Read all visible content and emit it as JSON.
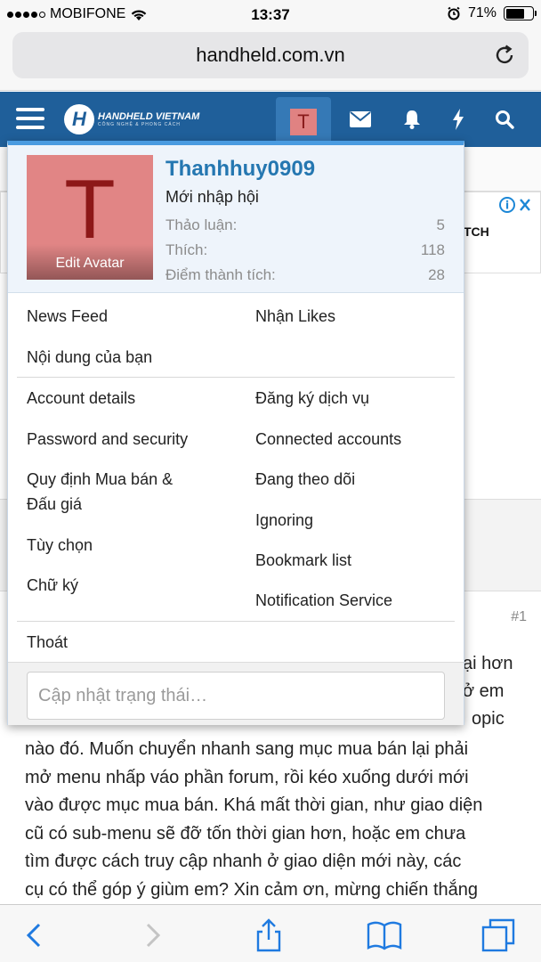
{
  "status_bar": {
    "carrier": "MOBIFONE",
    "time": "13:37",
    "battery_text": "71%",
    "battery_level": 0.71
  },
  "browser": {
    "url": "handheld.com.vn"
  },
  "site": {
    "logo_name": "HANDHELD VIETNAM",
    "logo_tagline": "CÔNG NGHỆ & PHONG CÁCH",
    "avatar_letter": "T",
    "header_color": "#1f5f9a"
  },
  "ad": {
    "brand_fragment": "TCH"
  },
  "popup": {
    "avatar_letter": "T",
    "edit_avatar": "Edit Avatar",
    "username": "Thanhhuy0909",
    "user_title": "Mới nhập hội",
    "stats": [
      {
        "label": "Thảo luận:",
        "value": "5"
      },
      {
        "label": "Thích:",
        "value": "118"
      },
      {
        "label": "Điểm thành tích:",
        "value": "28"
      }
    ],
    "links_top_left": [
      "News Feed",
      "Nội dung của bạn"
    ],
    "links_top_right": [
      "Nhận Likes"
    ],
    "account_left": [
      "Account details",
      "Password and security",
      "Quy định Mua bán &",
      "Đấu giá",
      "Tùy chọn",
      "Chữ ký"
    ],
    "account_right": [
      "Đăng ký dịch vụ",
      "Connected accounts",
      "Đang theo dõi",
      "Ignoring",
      "Bookmark list",
      "Notification Service"
    ],
    "logout": "Thoát",
    "status_placeholder": "Cập nhật trạng thái…",
    "accent_color": "#4a9be0",
    "username_color": "#2577b1"
  },
  "post": {
    "number": "#1",
    "peek_1": "ại hơn",
    "peek_2": "ở em",
    "peek_3": "opic",
    "lines": [
      "nào đó. Muốn chuyển nhanh sang mục mua bán lại phải",
      "mở menu nhấp váo phần forum, rồi kéo xuống dưới mới",
      "vào được mục mua bán. Khá mất thời gian, như giao diện",
      "cũ có sub-menu sẽ đỡ tốn thời gian hơn, hoặc em chưa",
      "tìm được cách truy cập nhanh ở giao diện mới này, các",
      "cụ có thể góp ý giùm em? Xin cảm ơn, mừng chiến thắng"
    ]
  }
}
